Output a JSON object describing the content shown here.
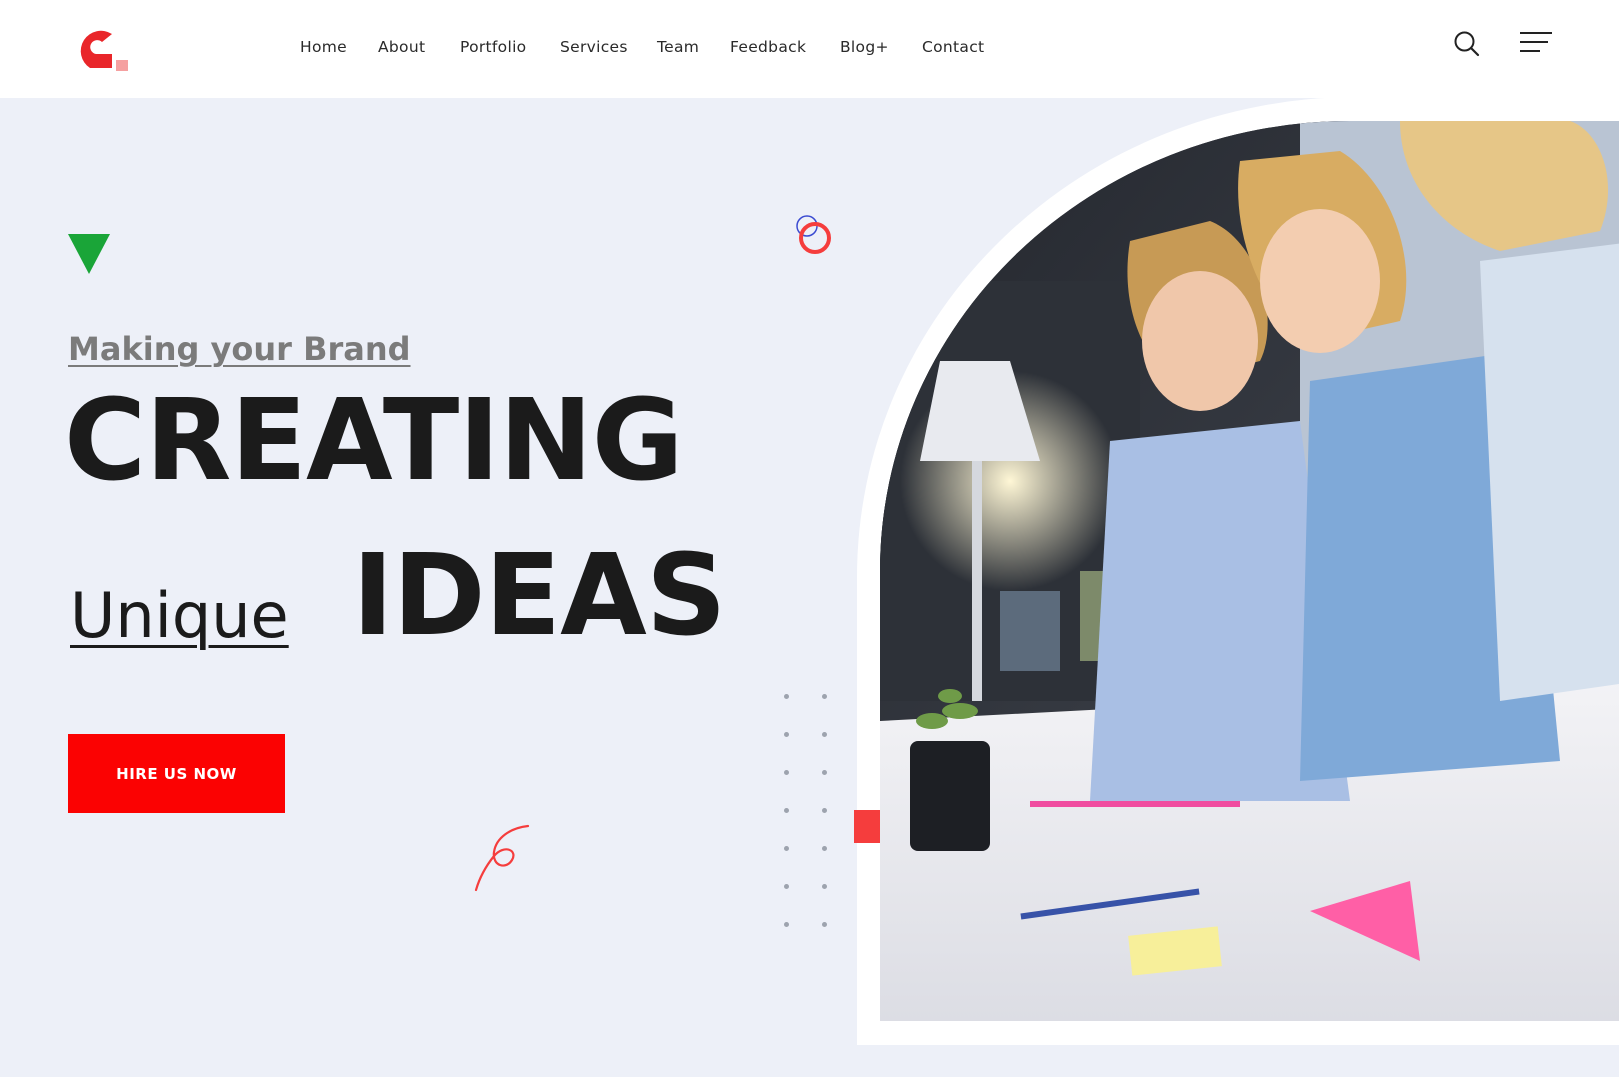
{
  "nav": {
    "items": [
      {
        "label": "Home"
      },
      {
        "label": "About"
      },
      {
        "label": "Portfolio"
      },
      {
        "label": "Services"
      },
      {
        "label": "Team"
      },
      {
        "label": "Feedback"
      },
      {
        "label": "Blog+"
      },
      {
        "label": "Contact"
      }
    ]
  },
  "header": {
    "search_icon": "search-icon",
    "menu_icon": "hamburger-menu-icon"
  },
  "hero": {
    "subtitle": "Making your Brand",
    "headline": "CREATING",
    "unique": "Unique",
    "ideas": "IDEAS",
    "cta_label": "HIRE US NOW"
  },
  "colors": {
    "brand_red": "#fb0202",
    "accent_green": "#1aa538",
    "hero_bg": "#edf0f8",
    "text_dark": "#1b1b1b"
  }
}
